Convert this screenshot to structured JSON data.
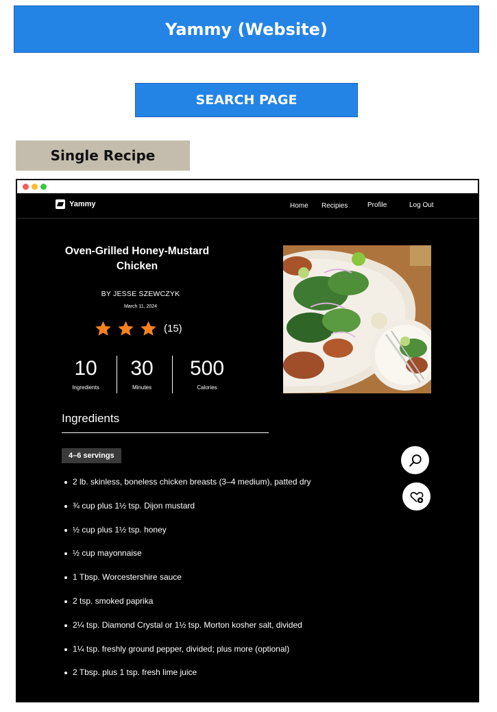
{
  "banner": {
    "title": "Yammy (Website)"
  },
  "search_tag": {
    "label": "SEARCH PAGE"
  },
  "section_tag": {
    "label": "Single Recipe"
  },
  "nav": {
    "brand": "Yammy",
    "links": [
      "Home",
      "Recipies",
      "Profile",
      "Log Out"
    ]
  },
  "recipe": {
    "title": "Oven-Grilled Honey-Mustard Chicken",
    "author": "BY JESSE  SZEWCZYK",
    "date": "March 11, 2024",
    "rating": {
      "stars": 3,
      "count": "(15)",
      "star_color": "#f5821f"
    },
    "stats": [
      {
        "value": "10",
        "label": "Ingredients"
      },
      {
        "value": "30",
        "label": "Minutes"
      },
      {
        "value": "500",
        "label": "Calories"
      }
    ]
  },
  "ingredients": {
    "heading": "Ingredients",
    "servings": "4–6 servings",
    "items": [
      "2 lb. skinless, boneless chicken breasts (3–4 medium), patted dry",
      "¾ cup plus 1½ tsp. Dijon mustard",
      "½ cup plus 1½ tsp. honey",
      "½ cup mayonnaise",
      "1 Tbsp. Worcestershire sauce",
      "2 tsp. smoked paprika",
      "2¼ tsp. Diamond Crystal or 1½ tsp. Morton kosher salt, divided",
      "1¼ tsp. freshly ground pepper, divided; plus more (optional)",
      "2 Tbsp. plus 1 tsp. fresh lime juice"
    ]
  },
  "actions": {
    "search_icon": "search-icon",
    "favorite_icon": "heart-plus-icon"
  },
  "colors": {
    "banner_blue": "#2484e6",
    "tag_beige": "#c4bdad",
    "page_bg": "#000000"
  }
}
